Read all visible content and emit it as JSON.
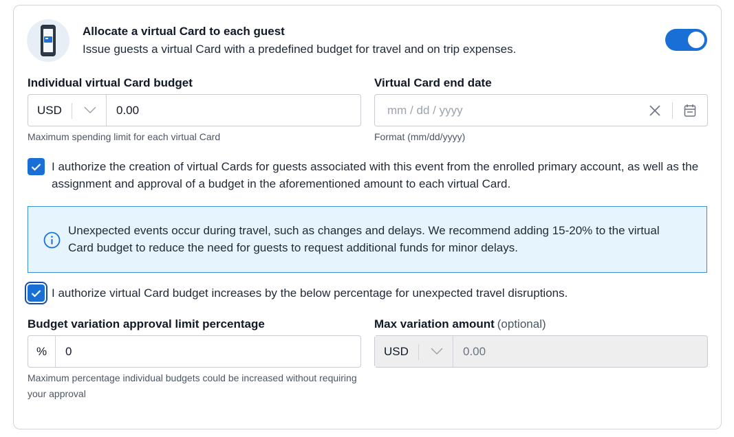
{
  "header": {
    "title": "Allocate a virtual Card to each guest",
    "subtitle": "Issue guests a virtual Card with a predefined budget for travel and on trip expenses.",
    "toggle_on": true
  },
  "budget": {
    "label": "Individual virtual Card budget",
    "currency": "USD",
    "value": "0.00",
    "help": "Maximum spending limit for each virtual Card"
  },
  "end_date": {
    "label": "Virtual Card end date",
    "placeholder": "mm / dd / yyyy",
    "help": "Format (mm/dd/yyyy)"
  },
  "authorize_creation": {
    "checked": true,
    "text": "I authorize the creation of virtual Cards for guests associated with this event from the enrolled primary account, as well as the assignment and approval of a budget in the aforementioned amount to each virtual Card."
  },
  "info": {
    "text": "Unexpected events occur during travel, such as changes and delays. We recommend adding 15-20% to the virtual Card budget to reduce the need for guests to request additional funds for minor delays."
  },
  "authorize_increase": {
    "checked": true,
    "text": "I authorize virtual Card budget increases by the below percentage for unexpected travel disruptions."
  },
  "variation_pct": {
    "label": "Budget variation approval limit percentage",
    "symbol": "%",
    "value": "0",
    "help": "Maximum percentage individual budgets could be increased without requiring your approval"
  },
  "max_variation": {
    "label": "Max variation amount",
    "optional": "(optional)",
    "currency": "USD",
    "value": "0.00"
  },
  "colors": {
    "accent": "#1a6fd6",
    "info_bg": "#e6f4fd",
    "info_border": "#3b8ed8"
  }
}
